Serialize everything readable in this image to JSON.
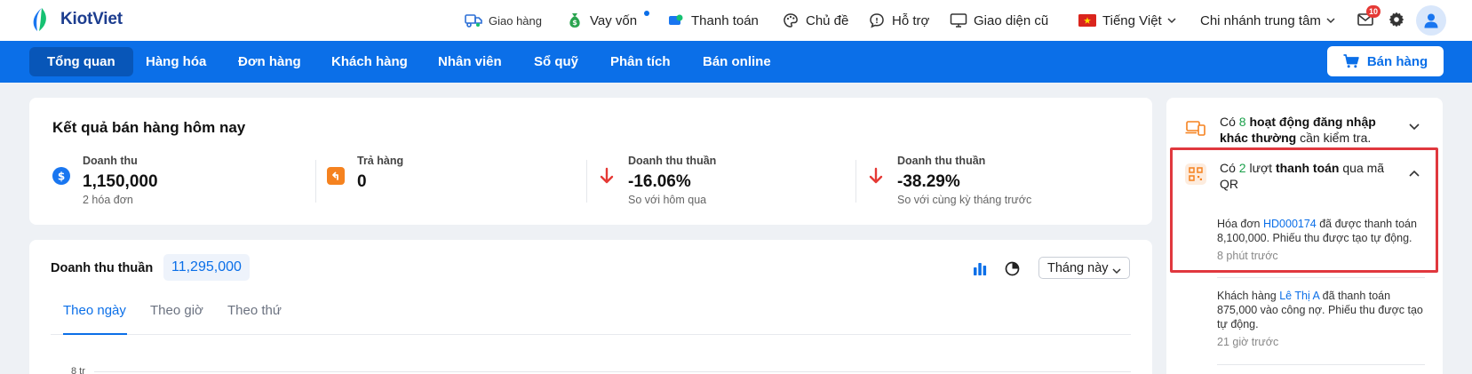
{
  "brand": {
    "name": "KiotViet"
  },
  "topnav": {
    "delivery": "Giao hàng",
    "loan": "Vay vốn",
    "payment": "Thanh toán",
    "theme": "Chủ đề",
    "support": "Hỗ trợ",
    "old_ui": "Giao diện cũ",
    "language": "Tiếng Việt",
    "branch": "Chi nhánh trung tâm",
    "mail_badge": "10"
  },
  "mainnav": {
    "items": [
      {
        "label": "Tổng quan"
      },
      {
        "label": "Hàng hóa"
      },
      {
        "label": "Đơn hàng"
      },
      {
        "label": "Khách hàng"
      },
      {
        "label": "Nhân viên"
      },
      {
        "label": "Sổ quỹ"
      },
      {
        "label": "Phân tích"
      },
      {
        "label": "Bán online"
      }
    ],
    "sell_button": "Bán hàng"
  },
  "results": {
    "title": "Kết quả bán hàng hôm nay",
    "stats": [
      {
        "label": "Doanh thu",
        "value": "1,150,000",
        "sub": "2 hóa đơn"
      },
      {
        "label": "Trả hàng",
        "value": "0",
        "sub": ""
      },
      {
        "label": "Doanh thu thuần",
        "value": "-16.06%",
        "sub": "So với hôm qua"
      },
      {
        "label": "Doanh thu thuần",
        "value": "-38.29%",
        "sub": "So với cùng kỳ tháng trước"
      }
    ]
  },
  "revenue": {
    "label": "Doanh thu thuần",
    "total": "11,295,000",
    "period": "Tháng này",
    "tabs": [
      "Theo ngày",
      "Theo giờ",
      "Theo thứ"
    ],
    "y_tick_top": "8 tr"
  },
  "activity": {
    "alert1": {
      "pre": "Có ",
      "count": "8",
      "bold": " hoạt động đăng nhập khác thường",
      "post": " cần kiểm tra."
    },
    "alert2": {
      "pre": "Có ",
      "count": "2",
      "mid": " lượt ",
      "bold": "thanh toán",
      "post": " qua mã QR"
    },
    "feed": [
      {
        "pre": "Hóa đơn ",
        "link": "HD000174",
        "post": " đã được thanh toán 8,100,000. Phiếu thu được tạo tự động.",
        "time": "8 phút trước"
      },
      {
        "pre": "Khách hàng ",
        "link": "Lê Thị A",
        "post": " đã thanh toán 875,000 vào công nợ. Phiếu thu được tạo tự động.",
        "time": "21 giờ trước"
      }
    ]
  },
  "colors": {
    "primary": "#0b6fe8",
    "active_nav": "#0856b8",
    "positive": "#1aa04a",
    "negative": "#e53935",
    "highlight": "#e0383e"
  }
}
